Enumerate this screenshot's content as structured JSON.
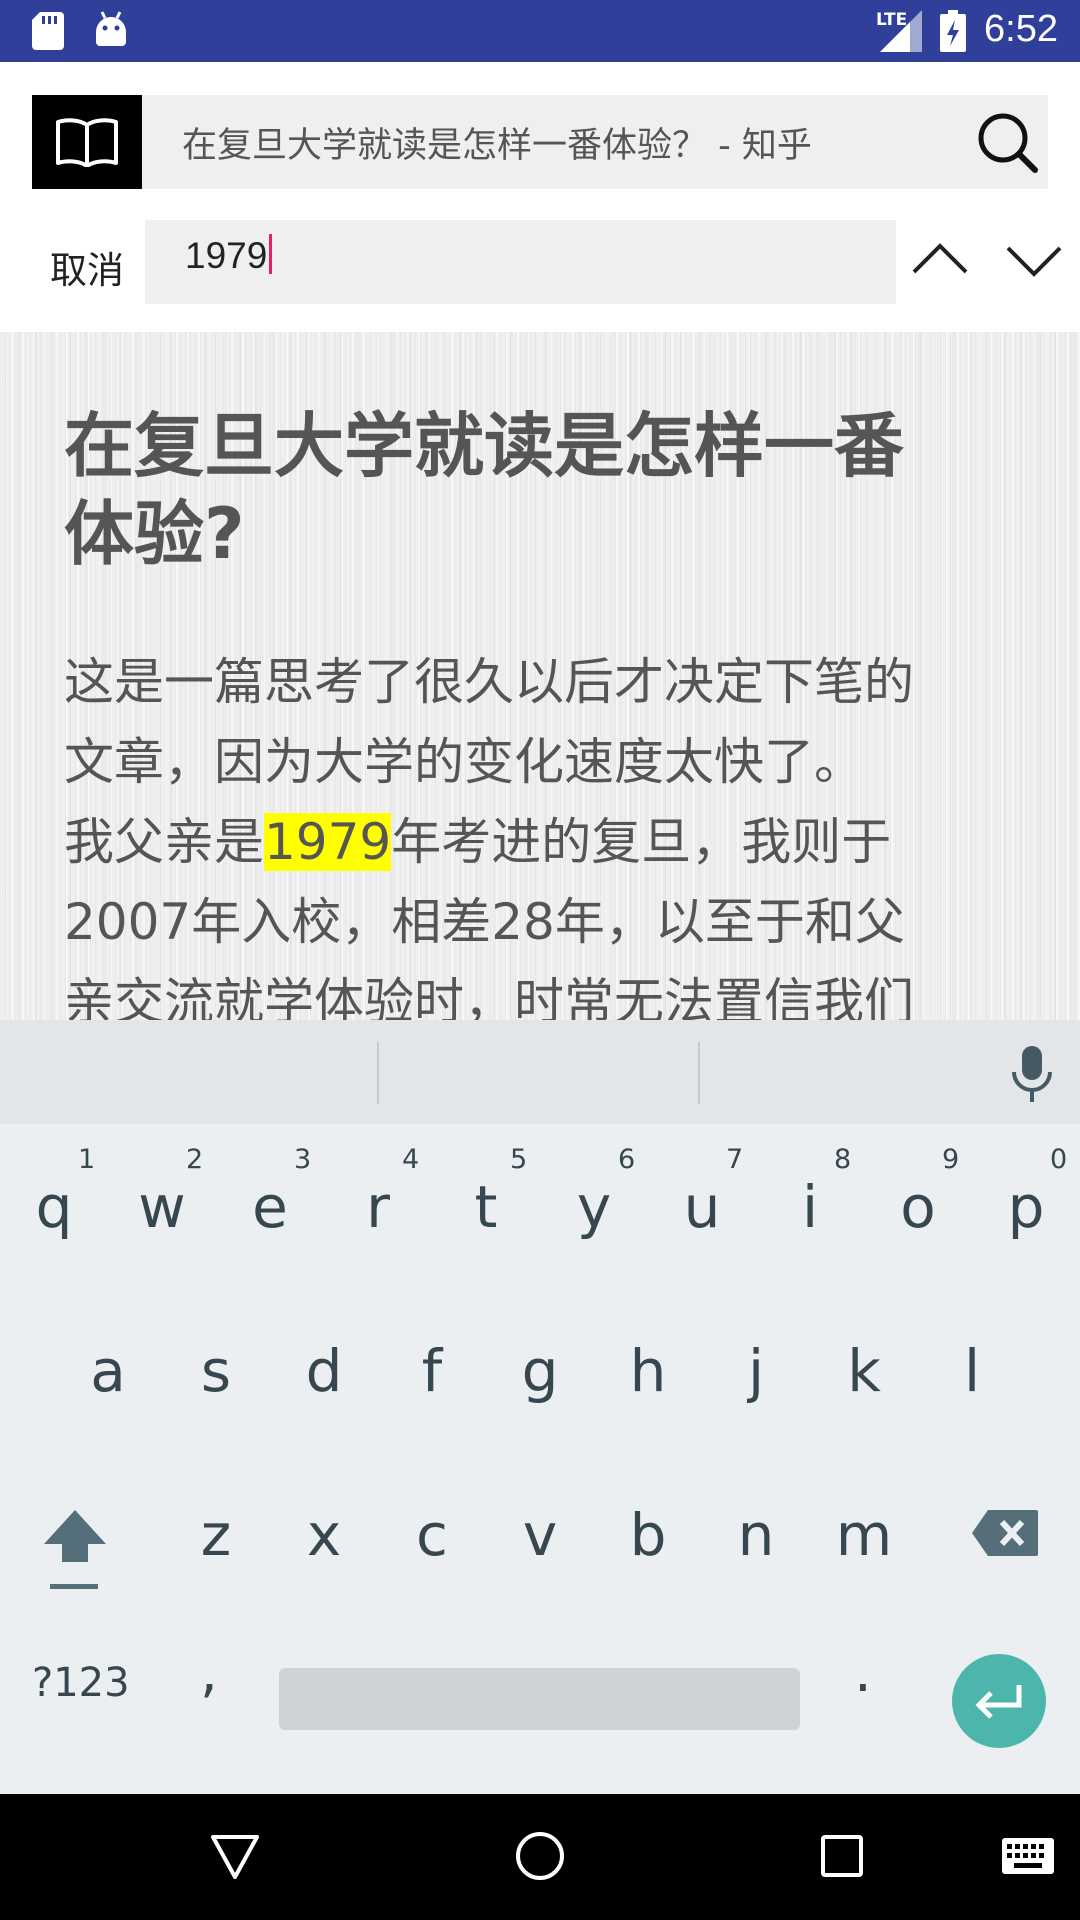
{
  "status_bar": {
    "time": "6:52",
    "network": "LTE",
    "icons": [
      "sd-card-icon",
      "android-icon",
      "lte-signal-icon",
      "battery-charging-icon"
    ]
  },
  "app_bar": {
    "title": "在复旦大学就读是怎样一番体验？ - 知乎",
    "icons": [
      "book-icon",
      "search-icon"
    ]
  },
  "find_bar": {
    "cancel_label": "取消",
    "query": "1979",
    "icons": [
      "chevron-up-icon",
      "chevron-down-icon"
    ]
  },
  "article": {
    "title_line1": "在复旦大学就读是怎样一番",
    "title_line2": "体验?",
    "body": {
      "line1": "这是一篇思考了很久以后才决定下笔的",
      "line2": "文章，因为大学的变化速度太快了。",
      "line3_before": "我父亲是",
      "line3_highlight": "1979",
      "line3_after": "年考进的复旦，我则于",
      "line4": "2007年入校，相差28年，以至于和父",
      "line5": "亲交流就学体验时，时常无法置信我们"
    },
    "highlight_color": "#ffff00"
  },
  "keyboard": {
    "row1": [
      "q",
      "w",
      "e",
      "r",
      "t",
      "y",
      "u",
      "i",
      "o",
      "p"
    ],
    "row1_hints": [
      "1",
      "2",
      "3",
      "4",
      "5",
      "6",
      "7",
      "8",
      "9",
      "0"
    ],
    "row2": [
      "a",
      "s",
      "d",
      "f",
      "g",
      "h",
      "j",
      "k",
      "l"
    ],
    "row3": [
      "z",
      "x",
      "c",
      "v",
      "b",
      "n",
      "m"
    ],
    "symbols_label": "?123",
    "comma_label": ",",
    "period_label": ".",
    "icons": [
      "mic-icon",
      "shift-icon",
      "backspace-icon",
      "enter-icon"
    ],
    "enter_color": "#4db6ac"
  },
  "nav_bar": {
    "icons": [
      "back-icon",
      "home-icon",
      "recents-icon",
      "keyboard-icon"
    ]
  },
  "colors": {
    "status_bar": "#2f3f9a",
    "cursor": "#e91e63"
  }
}
